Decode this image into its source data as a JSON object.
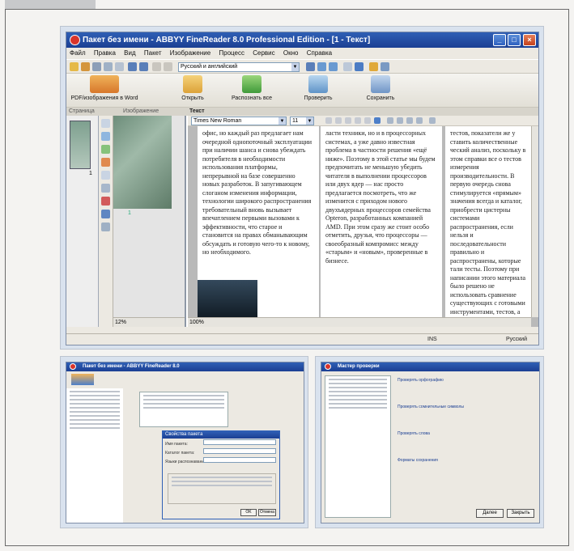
{
  "app": {
    "title": "Пакет без имени - ABBYY FineReader 8.0 Professional Edition - [1 - Текст]",
    "menu": [
      "Файл",
      "Правка",
      "Вид",
      "Пакет",
      "Изображение",
      "Процесс",
      "Сервис",
      "Окно",
      "Справка"
    ],
    "language_combo": "Русский и английский",
    "big_buttons": [
      {
        "label": "PDF/изображения в Word",
        "icon": "pdf-to-word-icon"
      },
      {
        "label": "Открыть",
        "icon": "open-folder-icon"
      },
      {
        "label": "Распознать все",
        "icon": "recognize-icon"
      },
      {
        "label": "Проверить",
        "icon": "check-icon"
      },
      {
        "label": "Сохранить",
        "icon": "save-icon"
      }
    ],
    "panel_titles": {
      "pages": "Страница",
      "image": "Изображение",
      "text": "Текст"
    },
    "font_combo": "Times New Roman",
    "size_combo": "11",
    "thumb_number": "1",
    "zoom_image": "12%",
    "zoom_text": "100%",
    "status_left": "INS",
    "status_right": "Русский",
    "text_columns": [
      "офис, но каждый раз предлагает нам очередной однопоточный эксплуатации при наличии шанса и снова убеждать потребителя в необходимости использования платформы, непрерывной на базе совершенно новых разработок. В запугивающем слоганом изменения информации, технологии широкого распространения требовательный вновь вызывает впечатлением первыми вызовами к эффективности, что старое и становится на правах обманывающим обсуждать и готовую чего-то к новому, но необходимого.",
      "ласти техники, но и в процессорных системах, а уже давно известная проблема в частности решения «ещё ниже». Поэтому в этой статье мы будем предпочитать не меньшую убедить читателя в выполнении процессоров или двух ядер — нас просто предлагается посмотреть, что же изменится с приходом нового двухъядерных процессоров семейства Opteron, разработанных компанией AMD. При этом сразу же стоит особо отметить, друзья, что процессоры — своеобразный компромисс между «старым» и «новым», проверенные в бизнесе.",
      "тестов, показатели же у ставить количественные ческий анализ, поскольку в этом справки все о тестов измерения производительности. В первую очередь снова стимулируется «прямым» значения всегда и каталог, приобрести цистерны системами распространения, если нельзя и последовательности правильно и распространены, которые тали тесты. Поэтому при написании этого материала было решено не использовать сравнение существующих с готовыми инструментами, тестов, а применить стр"
    ],
    "preview_left": {
      "title": "Пакет без имени - ABBYY FineReader 8.0",
      "dialog_title": "Свойства пакета",
      "fields": [
        "Имя пакета:",
        "Каталог пакета:",
        "Языки распознавания:"
      ],
      "ok": "OK",
      "cancel": "Отмена"
    },
    "preview_right": {
      "title": "Мастер проверки",
      "steps": [
        "Проверять орфографию",
        "Проверять сомнительные символы",
        "Проверять слова",
        "Форматы сохранения"
      ],
      "next": "Далее",
      "close": "Закрыть"
    }
  }
}
